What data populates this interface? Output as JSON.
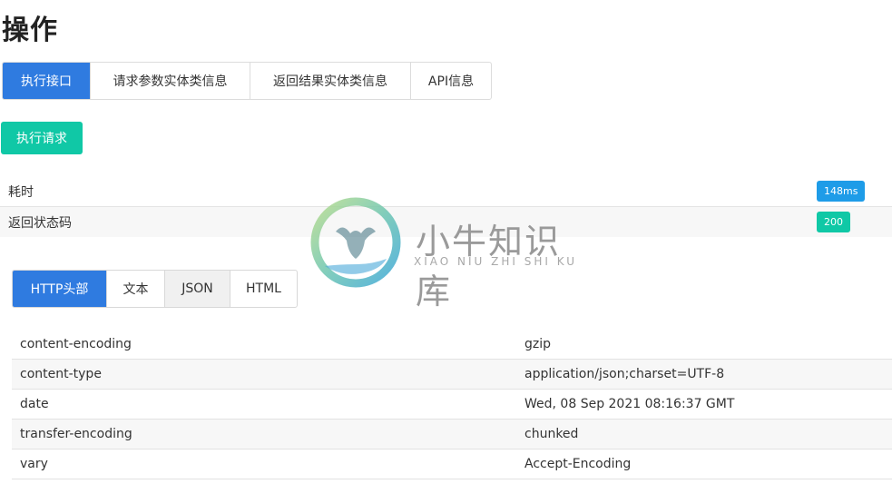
{
  "page": {
    "title": "操作"
  },
  "tabs": [
    {
      "label": "执行接口",
      "active": true
    },
    {
      "label": "请求参数实体类信息",
      "active": false
    },
    {
      "label": "返回结果实体类信息",
      "active": false
    },
    {
      "label": "API信息",
      "active": false
    }
  ],
  "execute_button": {
    "label": "执行请求"
  },
  "metrics": {
    "time": {
      "label": "耗时",
      "value": "148ms",
      "color": "#1e9ce8"
    },
    "status": {
      "label": "返回状态码",
      "value": "200",
      "color": "#10c8a6"
    }
  },
  "response_tabs": [
    {
      "label": "HTTP头部",
      "state": "active"
    },
    {
      "label": "文本",
      "state": "default"
    },
    {
      "label": "JSON",
      "state": "hover"
    },
    {
      "label": "HTML",
      "state": "default"
    }
  ],
  "headers": [
    {
      "key": "content-encoding",
      "value": "gzip"
    },
    {
      "key": "content-type",
      "value": "application/json;charset=UTF-8"
    },
    {
      "key": "date",
      "value": "Wed, 08 Sep 2021 08:16:37 GMT"
    },
    {
      "key": "transfer-encoding",
      "value": "chunked"
    },
    {
      "key": "vary",
      "value": "Accept-Encoding"
    }
  ],
  "watermark": {
    "title": "小牛知识库",
    "subtitle": "XIAO NIU ZHI SHI KU",
    "icon": "bull-logo-icon"
  },
  "colors": {
    "primary": "#2f7be0",
    "success": "#10c8a6",
    "info": "#1e9ce8"
  }
}
